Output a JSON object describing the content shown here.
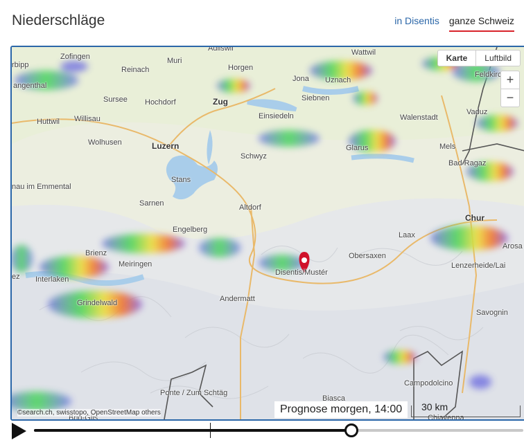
{
  "page": {
    "title": "Niederschläge"
  },
  "scope_tabs": [
    {
      "label": "in Disentis",
      "active": false
    },
    {
      "label": "ganze Schweiz",
      "active": true
    }
  ],
  "map": {
    "layer_buttons": [
      {
        "label": "Karte",
        "active": true
      },
      {
        "label": "Luftbild",
        "active": false
      }
    ],
    "zoom_in": "+",
    "zoom_out": "−",
    "attribution": "©search.ch, swisstopo, OpenStreetMap others",
    "scale_label": "30 km",
    "places": {
      "zofingen": "Zofingen",
      "reinach": "Reinach",
      "muri": "Muri",
      "adliswil": "Adliswil",
      "wattwil": "Wattwil",
      "horgen": "Horgen",
      "jona": "Jona",
      "uznach": "Uznach",
      "feldkirch": "Feldkirch",
      "sursee": "Sursee",
      "hochdorf": "Hochdorf",
      "zug": "Zug",
      "siebnen": "Siebnen",
      "huttwil": "Huttwil",
      "willisau": "Willisau",
      "einsiedeln": "Einsiedeln",
      "walenstadt": "Walenstadt",
      "vaduz": "Vaduz",
      "wolhusen": "Wolhusen",
      "luzern": "Luzern",
      "glarus": "Glarus",
      "mels": "Mels",
      "schwyz": "Schwyz",
      "bad_ragaz": "Bad Ragaz",
      "langnau": "nau im Emmental",
      "stans": "Stans",
      "sarnen": "Sarnen",
      "altdorf": "Altdorf",
      "chur": "Chur",
      "engelberg": "Engelberg",
      "laax": "Laax",
      "brienz": "Brienz",
      "meiringen": "Meiringen",
      "obersaxen": "Obersaxen",
      "arosa": "Arosa",
      "lenzerheide": "Lenzerheide/Lai",
      "interlaken": "Interlaken",
      "disentis": "Disentis/Mustér",
      "andermatt": "Andermatt",
      "grindelwald": "Grindelwald",
      "savognin": "Savognin",
      "campodolcino": "Campodolcino",
      "ponte": "Ponte / Zum Schtäg",
      "biasca": "Biasca",
      "langenthal": "angenthal",
      "burgdorf": "rbipp",
      "chiavenna": "Chiavenna",
      "brig": "Brig-Glis",
      "spiez": "ez"
    }
  },
  "timeline": {
    "forecast_label": "Prognose morgen, 14:00",
    "progress": 0.647,
    "now_marker": 0.36
  },
  "colors": {
    "accent": "#2a66a8",
    "active_underline": "#d8232a",
    "marker": "#d0112b"
  }
}
